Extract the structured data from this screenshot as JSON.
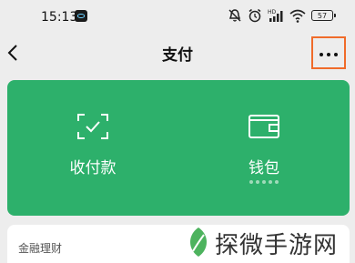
{
  "status_bar": {
    "time": "15:13",
    "battery": "57"
  },
  "nav": {
    "title": "支付"
  },
  "wallet_card": {
    "functions": [
      {
        "label": "收付款"
      },
      {
        "label": "钱包"
      }
    ]
  },
  "list": {
    "item_label": "金融理财"
  },
  "watermark": {
    "text": "探微手游网"
  },
  "colors": {
    "accent": "#2db06b",
    "highlight": "#f06b2a",
    "background": "#ededed"
  }
}
